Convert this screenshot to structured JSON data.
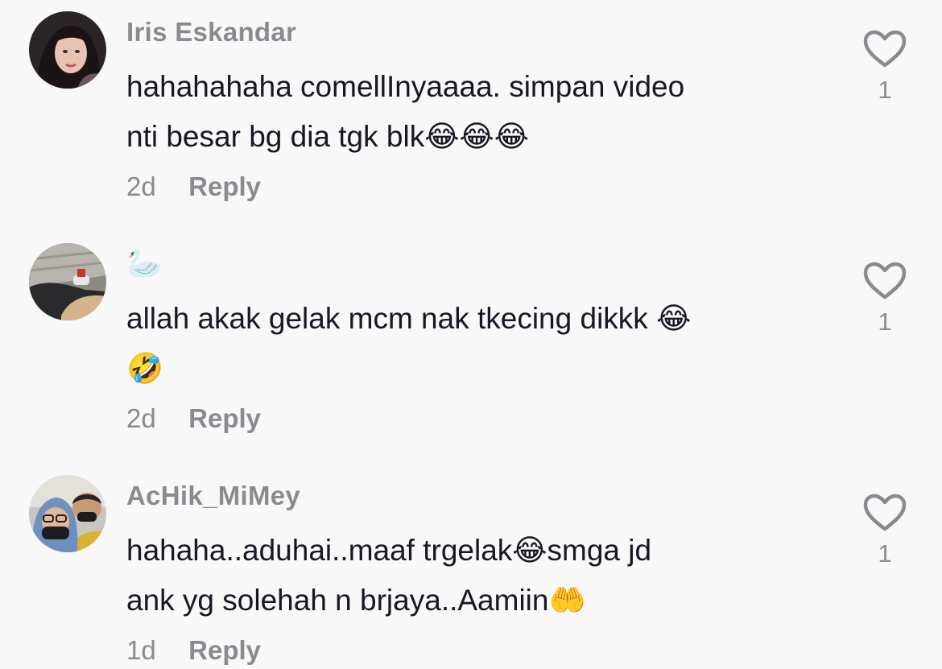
{
  "comments": [
    {
      "username": "Iris Eskandar",
      "lines": [
        "hahahahaha comellInyaaaa. simpan video",
        "nti besar bg dia tgk blk😂😂😂"
      ],
      "time": "2d",
      "reply_label": "Reply",
      "likes": "1",
      "avatar_icon": "profile-photo-woman"
    },
    {
      "username": "🦢",
      "lines": [
        "allah akak gelak mcm nak tkecing dikkk 😂",
        "🤣"
      ],
      "time": "2d",
      "reply_label": "Reply",
      "likes": "1",
      "avatar_icon": "profile-photo-legs"
    },
    {
      "username": "AcHik_MiMey",
      "lines": [
        "hahaha..aduhai..maaf trgelak😂smga jd",
        "ank yg solehah n brjaya..Aamiin🤲"
      ],
      "time": "1d",
      "reply_label": "Reply",
      "likes": "1",
      "avatar_icon": "profile-photo-couple"
    }
  ],
  "icons": {
    "like": "heart-outline-icon"
  },
  "colors": {
    "background": "#f8f8f8",
    "text": "#161823",
    "muted": "#8a8b91"
  }
}
